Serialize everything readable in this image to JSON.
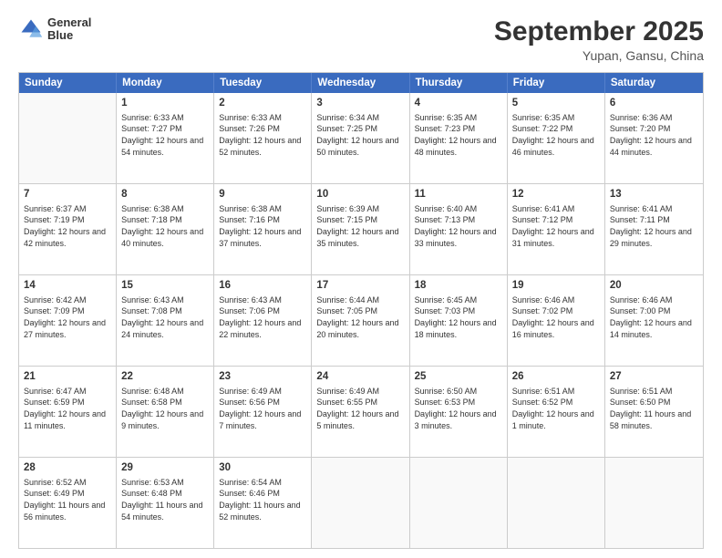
{
  "header": {
    "logo_line1": "General",
    "logo_line2": "Blue",
    "title": "September 2025",
    "location": "Yupan, Gansu, China"
  },
  "days_of_week": [
    "Sunday",
    "Monday",
    "Tuesday",
    "Wednesday",
    "Thursday",
    "Friday",
    "Saturday"
  ],
  "weeks": [
    [
      {
        "day": "",
        "sunrise": "",
        "sunset": "",
        "daylight": ""
      },
      {
        "day": "1",
        "sunrise": "Sunrise: 6:33 AM",
        "sunset": "Sunset: 7:27 PM",
        "daylight": "Daylight: 12 hours and 54 minutes."
      },
      {
        "day": "2",
        "sunrise": "Sunrise: 6:33 AM",
        "sunset": "Sunset: 7:26 PM",
        "daylight": "Daylight: 12 hours and 52 minutes."
      },
      {
        "day": "3",
        "sunrise": "Sunrise: 6:34 AM",
        "sunset": "Sunset: 7:25 PM",
        "daylight": "Daylight: 12 hours and 50 minutes."
      },
      {
        "day": "4",
        "sunrise": "Sunrise: 6:35 AM",
        "sunset": "Sunset: 7:23 PM",
        "daylight": "Daylight: 12 hours and 48 minutes."
      },
      {
        "day": "5",
        "sunrise": "Sunrise: 6:35 AM",
        "sunset": "Sunset: 7:22 PM",
        "daylight": "Daylight: 12 hours and 46 minutes."
      },
      {
        "day": "6",
        "sunrise": "Sunrise: 6:36 AM",
        "sunset": "Sunset: 7:20 PM",
        "daylight": "Daylight: 12 hours and 44 minutes."
      }
    ],
    [
      {
        "day": "7",
        "sunrise": "Sunrise: 6:37 AM",
        "sunset": "Sunset: 7:19 PM",
        "daylight": "Daylight: 12 hours and 42 minutes."
      },
      {
        "day": "8",
        "sunrise": "Sunrise: 6:38 AM",
        "sunset": "Sunset: 7:18 PM",
        "daylight": "Daylight: 12 hours and 40 minutes."
      },
      {
        "day": "9",
        "sunrise": "Sunrise: 6:38 AM",
        "sunset": "Sunset: 7:16 PM",
        "daylight": "Daylight: 12 hours and 37 minutes."
      },
      {
        "day": "10",
        "sunrise": "Sunrise: 6:39 AM",
        "sunset": "Sunset: 7:15 PM",
        "daylight": "Daylight: 12 hours and 35 minutes."
      },
      {
        "day": "11",
        "sunrise": "Sunrise: 6:40 AM",
        "sunset": "Sunset: 7:13 PM",
        "daylight": "Daylight: 12 hours and 33 minutes."
      },
      {
        "day": "12",
        "sunrise": "Sunrise: 6:41 AM",
        "sunset": "Sunset: 7:12 PM",
        "daylight": "Daylight: 12 hours and 31 minutes."
      },
      {
        "day": "13",
        "sunrise": "Sunrise: 6:41 AM",
        "sunset": "Sunset: 7:11 PM",
        "daylight": "Daylight: 12 hours and 29 minutes."
      }
    ],
    [
      {
        "day": "14",
        "sunrise": "Sunrise: 6:42 AM",
        "sunset": "Sunset: 7:09 PM",
        "daylight": "Daylight: 12 hours and 27 minutes."
      },
      {
        "day": "15",
        "sunrise": "Sunrise: 6:43 AM",
        "sunset": "Sunset: 7:08 PM",
        "daylight": "Daylight: 12 hours and 24 minutes."
      },
      {
        "day": "16",
        "sunrise": "Sunrise: 6:43 AM",
        "sunset": "Sunset: 7:06 PM",
        "daylight": "Daylight: 12 hours and 22 minutes."
      },
      {
        "day": "17",
        "sunrise": "Sunrise: 6:44 AM",
        "sunset": "Sunset: 7:05 PM",
        "daylight": "Daylight: 12 hours and 20 minutes."
      },
      {
        "day": "18",
        "sunrise": "Sunrise: 6:45 AM",
        "sunset": "Sunset: 7:03 PM",
        "daylight": "Daylight: 12 hours and 18 minutes."
      },
      {
        "day": "19",
        "sunrise": "Sunrise: 6:46 AM",
        "sunset": "Sunset: 7:02 PM",
        "daylight": "Daylight: 12 hours and 16 minutes."
      },
      {
        "day": "20",
        "sunrise": "Sunrise: 6:46 AM",
        "sunset": "Sunset: 7:00 PM",
        "daylight": "Daylight: 12 hours and 14 minutes."
      }
    ],
    [
      {
        "day": "21",
        "sunrise": "Sunrise: 6:47 AM",
        "sunset": "Sunset: 6:59 PM",
        "daylight": "Daylight: 12 hours and 11 minutes."
      },
      {
        "day": "22",
        "sunrise": "Sunrise: 6:48 AM",
        "sunset": "Sunset: 6:58 PM",
        "daylight": "Daylight: 12 hours and 9 minutes."
      },
      {
        "day": "23",
        "sunrise": "Sunrise: 6:49 AM",
        "sunset": "Sunset: 6:56 PM",
        "daylight": "Daylight: 12 hours and 7 minutes."
      },
      {
        "day": "24",
        "sunrise": "Sunrise: 6:49 AM",
        "sunset": "Sunset: 6:55 PM",
        "daylight": "Daylight: 12 hours and 5 minutes."
      },
      {
        "day": "25",
        "sunrise": "Sunrise: 6:50 AM",
        "sunset": "Sunset: 6:53 PM",
        "daylight": "Daylight: 12 hours and 3 minutes."
      },
      {
        "day": "26",
        "sunrise": "Sunrise: 6:51 AM",
        "sunset": "Sunset: 6:52 PM",
        "daylight": "Daylight: 12 hours and 1 minute."
      },
      {
        "day": "27",
        "sunrise": "Sunrise: 6:51 AM",
        "sunset": "Sunset: 6:50 PM",
        "daylight": "Daylight: 11 hours and 58 minutes."
      }
    ],
    [
      {
        "day": "28",
        "sunrise": "Sunrise: 6:52 AM",
        "sunset": "Sunset: 6:49 PM",
        "daylight": "Daylight: 11 hours and 56 minutes."
      },
      {
        "day": "29",
        "sunrise": "Sunrise: 6:53 AM",
        "sunset": "Sunset: 6:48 PM",
        "daylight": "Daylight: 11 hours and 54 minutes."
      },
      {
        "day": "30",
        "sunrise": "Sunrise: 6:54 AM",
        "sunset": "Sunset: 6:46 PM",
        "daylight": "Daylight: 11 hours and 52 minutes."
      },
      {
        "day": "",
        "sunrise": "",
        "sunset": "",
        "daylight": ""
      },
      {
        "day": "",
        "sunrise": "",
        "sunset": "",
        "daylight": ""
      },
      {
        "day": "",
        "sunrise": "",
        "sunset": "",
        "daylight": ""
      },
      {
        "day": "",
        "sunrise": "",
        "sunset": "",
        "daylight": ""
      }
    ]
  ]
}
